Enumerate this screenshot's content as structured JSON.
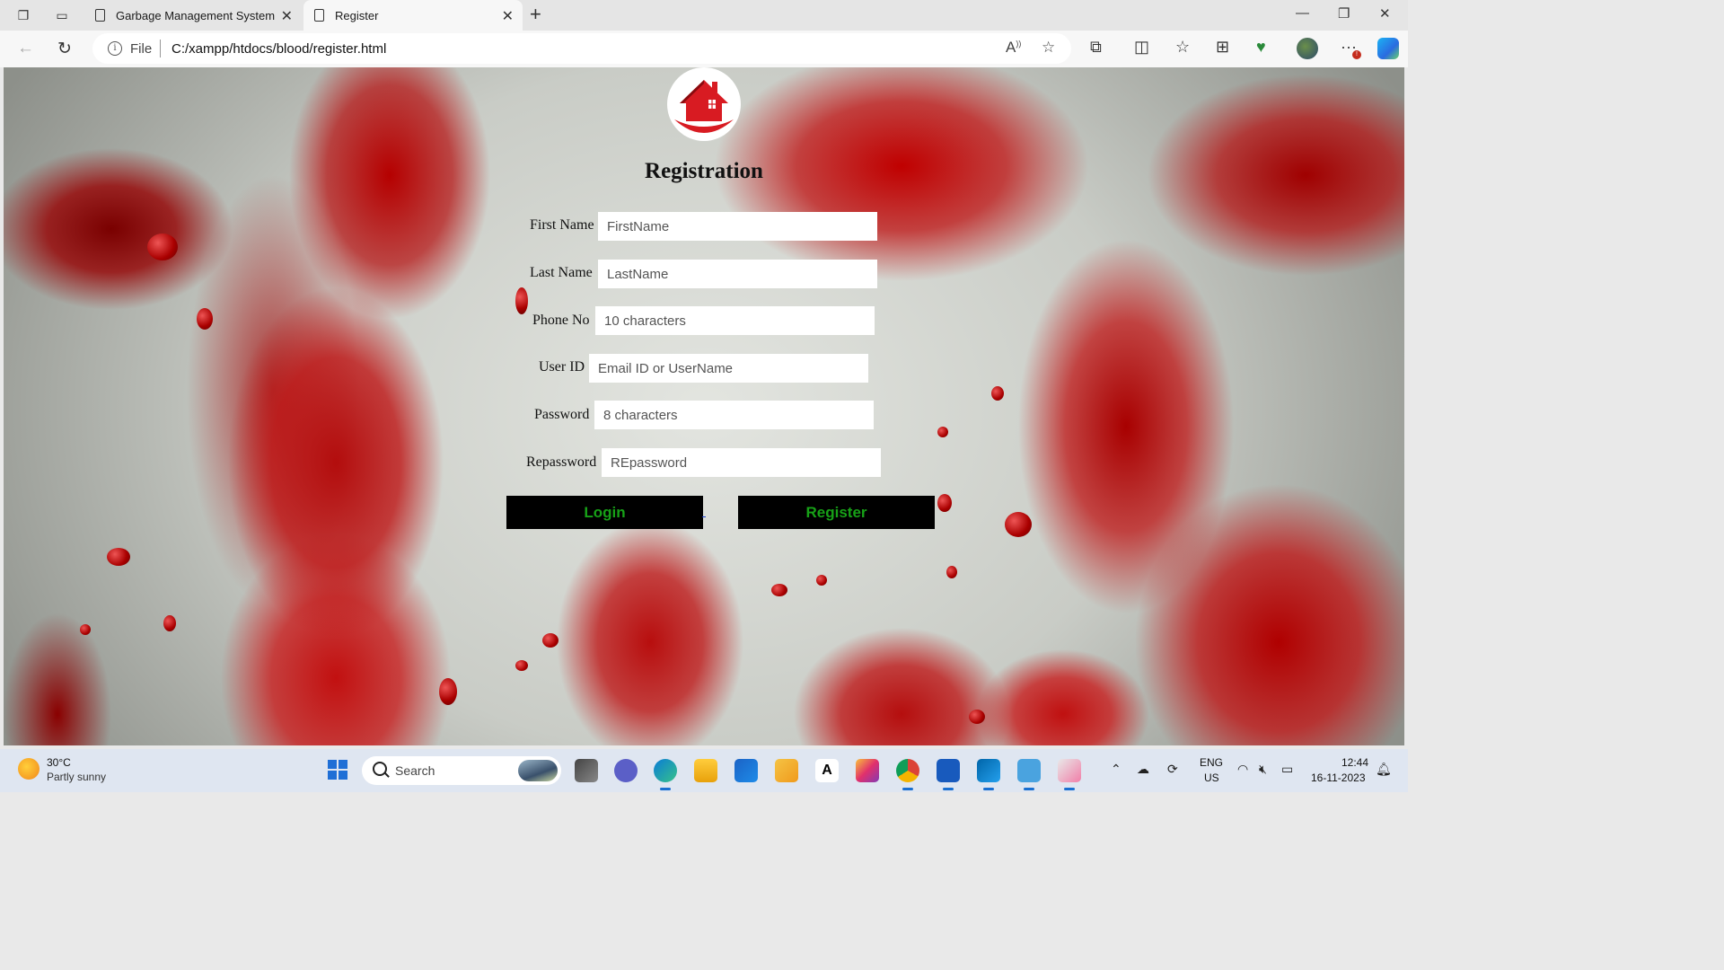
{
  "browser": {
    "tabs": [
      {
        "title": "Garbage Management System"
      },
      {
        "title": "Register"
      }
    ],
    "address": {
      "scheme_label": "File",
      "url": "C:/xampp/htdocs/blood/register.html"
    }
  },
  "form": {
    "title": "Registration",
    "fields": [
      {
        "label": "First Name",
        "placeholder": "FirstName"
      },
      {
        "label": "Last Name",
        "placeholder": "LastName"
      },
      {
        "label": "Phone No",
        "placeholder": "10 characters"
      },
      {
        "label": "User ID",
        "placeholder": "Email ID or UserName"
      },
      {
        "label": "Password",
        "placeholder": "8 characters"
      },
      {
        "label": "Repassword",
        "placeholder": "REpassword"
      }
    ],
    "login_label": "Login",
    "register_label": "Register",
    "button_text_color": "#17a117",
    "button_bg": "#000000"
  },
  "taskbar": {
    "weather_temp": "30°C",
    "weather_desc": "Partly sunny",
    "search_label": "Search",
    "lang_1": "ENG",
    "lang_2": "US",
    "time": "12:44",
    "date": "16-11-2023"
  }
}
